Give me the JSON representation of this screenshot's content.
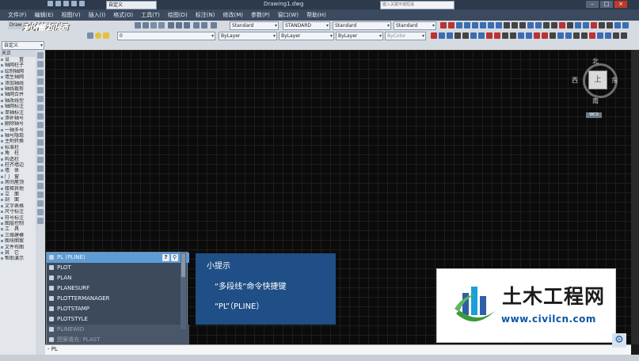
{
  "window": {
    "doc_title": "Drawing1.dwg",
    "workspace": "自定义",
    "search_placeholder": "键入关键字或短语"
  },
  "menu": [
    "文件(F)",
    "编辑(E)",
    "视图(V)",
    "插入(I)",
    "格式(O)",
    "工具(T)",
    "绘图(D)",
    "标注(N)",
    "修改(M)",
    "参数(P)",
    "窗口(W)",
    "帮助(H)"
  ],
  "toolbar": {
    "drawing_tab": "Draw",
    "logo_text": "秒懂视频",
    "text_style": "Standard",
    "dim_style": "STANDARD",
    "table_style": "Standard",
    "multileader_style": "Standard",
    "layer": "0",
    "workspace2": "自定义",
    "color": "ByLayer",
    "linetype": "ByLayer",
    "lineweight": "ByLayer",
    "plotstyle": "ByColor"
  },
  "left_panel": {
    "header": "天正",
    "items": [
      "设　　置",
      "轴网柱子",
      "绘制轴网",
      "墙生轴网",
      "添加轴线",
      "轴线裁剪",
      "轴网合并",
      "轴改线型",
      "轴网标注",
      "单轴标注",
      "添补轴号",
      "删除轴号",
      "一轴多号",
      "轴号隐现",
      "主附转换",
      "标准柱",
      "角　柱",
      "构造柱",
      "柱齐墙边",
      "墙　体",
      "门　窗",
      "房间屋顶",
      "楼梯其他",
      "立　面",
      "剖　面",
      "文字表格",
      "尺寸标注",
      "符号标注",
      "图层控制",
      "工　具",
      "三维建模",
      "图块图案",
      "文件布图",
      "其　它",
      "帮助演示"
    ]
  },
  "viewcube": {
    "north": "北",
    "south": "南",
    "east": "东",
    "west": "西",
    "top_face": "上",
    "wcs": "WCS"
  },
  "autocomplete": {
    "items": [
      "PL (PLINE)",
      "PLOT",
      "PLAN",
      "PLANESURF",
      "PLOTTERMANAGER",
      "PLOTSTAMP",
      "PLOTSTYLE",
      "PLINEWID",
      "图案填充: PLAST"
    ],
    "help_icon": "?",
    "selected_index": 0
  },
  "command_line": {
    "value": "- PL"
  },
  "tip": {
    "title": "小提示",
    "line1": "“多段线”命令快捷键",
    "line2": "“PL”（PLINE）"
  },
  "watermark": {
    "name": "土木工程网",
    "url": "www.civilcn.com"
  },
  "colors": {
    "canvas": "#0b0b0b",
    "tip_bg": "#1f4f86",
    "autocomplete_bg": "#3c4a5c",
    "autocomplete_selected": "#5d9bd5",
    "watermark_url": "#0c56a6"
  }
}
